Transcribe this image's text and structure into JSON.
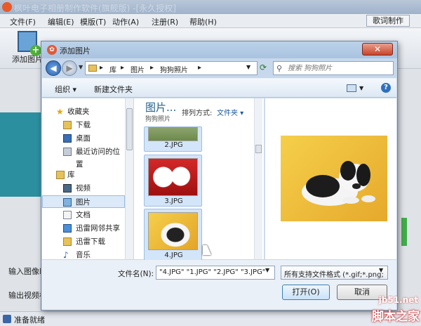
{
  "app": {
    "title": "枫叶电子相册制作软件(旗舰版) -[永久授权]",
    "menu": [
      "文件(F)",
      "编辑(E)",
      "模版(T)",
      "动作(A)",
      "注册(R)",
      "帮助(H)"
    ],
    "lyric_button": "歌词制作",
    "add_image_label": "添加图片",
    "bottom_labels": [
      "输入图像时",
      "输出视频格"
    ],
    "status": "准备就绪"
  },
  "dialog": {
    "title": "添加图片",
    "close_label": "✕",
    "breadcrumbs": [
      "库",
      "图片",
      "狗狗照片"
    ],
    "search_placeholder": "搜索 狗狗照片",
    "organize_label": "组织 ▾",
    "new_folder_label": "新建文件夹",
    "nav_items": [
      {
        "label": "收藏夹",
        "icon": "star-icon"
      },
      {
        "label": "下载",
        "icon": "download-folder-icon"
      },
      {
        "label": "桌面",
        "icon": "desktop-icon"
      },
      {
        "label": "最近访问的位置",
        "icon": "recent-places-icon"
      },
      {
        "label": "库",
        "icon": "library-icon"
      },
      {
        "label": "视频",
        "icon": "video-library-icon"
      },
      {
        "label": "图片",
        "icon": "pictures-library-icon"
      },
      {
        "label": "文档",
        "icon": "documents-library-icon"
      },
      {
        "label": "迅雷网邻共享",
        "icon": "share-icon"
      },
      {
        "label": "迅雷下载",
        "icon": "folder-icon"
      },
      {
        "label": "音乐",
        "icon": "music-library-icon"
      }
    ],
    "library_title": "图片...",
    "library_subtitle": "狗狗照片",
    "arrange_label": "排列方式:",
    "arrange_value": "文件夹 ▾",
    "files": [
      {
        "name": "2.JPG",
        "selected": true
      },
      {
        "name": "3.JPG",
        "selected": true
      },
      {
        "name": "4.JPG",
        "selected": true
      }
    ],
    "filename_label": "文件名(N):",
    "filename_value": "\"4.JPG\" \"1.JPG\" \"2.JPG\" \"3.JPG\"",
    "filetype_value": "所有支持文件格式 (*.gif;*.png;",
    "open_label": "打开(O)",
    "cancel_label": "取消"
  },
  "watermark": {
    "url": "jb51.net",
    "text": "脚本之家"
  },
  "colors": {
    "dialog_frame": "#c7d8ec",
    "accent": "#1c5aa6",
    "selection": "#d3e5f8"
  }
}
